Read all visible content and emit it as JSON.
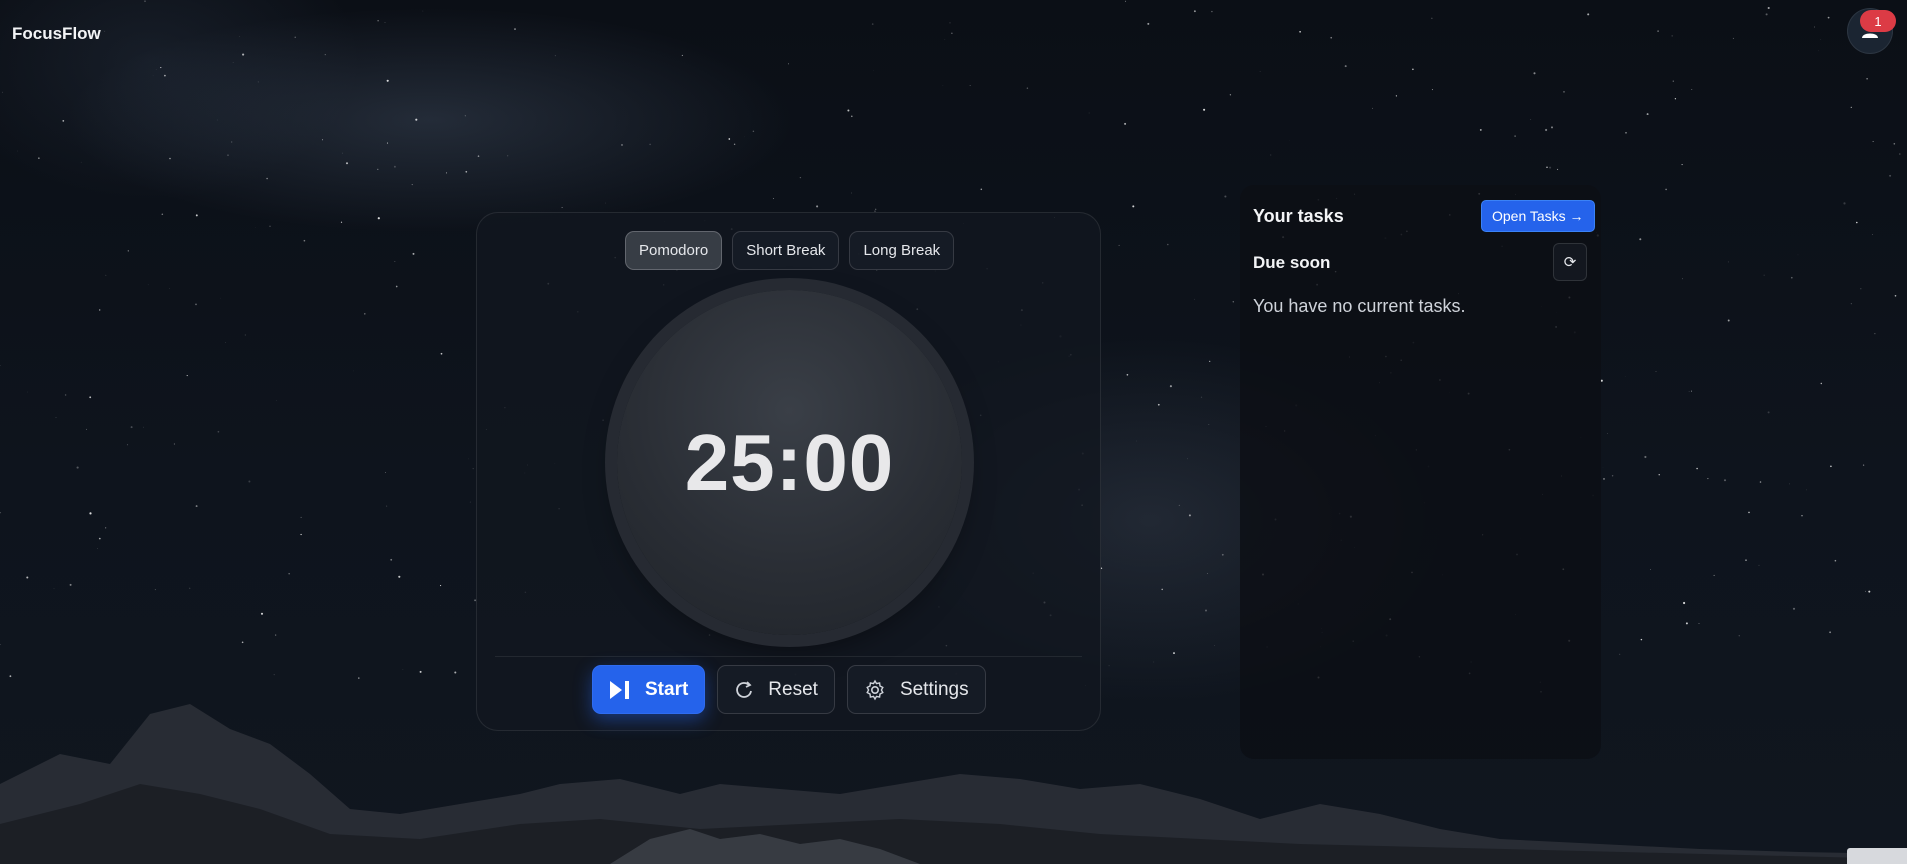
{
  "app": {
    "brand": "FocusFlow",
    "notification_count": "1",
    "avatar_icon": "user-icon"
  },
  "timer": {
    "modes": [
      {
        "label": "Pomodoro",
        "active": true
      },
      {
        "label": "Short Break",
        "active": false
      },
      {
        "label": "Long Break",
        "active": false
      }
    ],
    "time": "25:00",
    "controls": {
      "start_label": "Start",
      "start_icon": "play-pause-icon",
      "reset_label": "Reset",
      "reset_icon": "refresh-icon",
      "settings_label": "Settings",
      "settings_icon": "gear-icon"
    }
  },
  "tasks": {
    "title": "Your tasks",
    "open_label": "Open Tasks →",
    "due_title": "Due soon",
    "refresh_symbol": "⟳",
    "empty_message": "You have no current tasks."
  },
  "colors": {
    "accent": "#2563eb",
    "badge": "#dc3b45",
    "background": "#0b0f16"
  }
}
